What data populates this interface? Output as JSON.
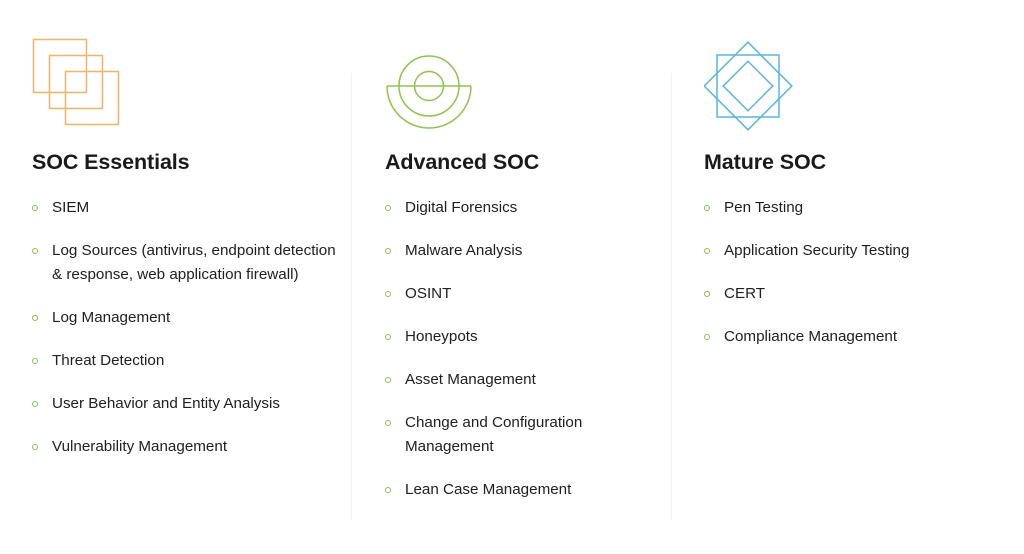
{
  "page": {
    "background_color": "#ffffff",
    "divider_color": "#f2f2f4",
    "bullet_color": "#8dbf4f",
    "title_color": "#1a1a1a",
    "text_color": "#20201f"
  },
  "columns": [
    {
      "id": "soc-essentials",
      "title": "SOC Essentials",
      "icon": "overlapping-squares-icon",
      "icon_color": "#e8b873",
      "items": [
        "SIEM",
        "Log Sources (antivirus, endpoint detection & response, web application firewall)",
        "Log Management",
        "Threat Detection",
        "User Behavior and Entity Analysis",
        "Vulnerability Management"
      ]
    },
    {
      "id": "advanced-soc",
      "title": "Advanced SOC",
      "icon": "concentric-circles-icon",
      "icon_color": "#8fc250",
      "items": [
        "Digital Forensics",
        "Malware Analysis",
        "OSINT",
        "Honeypots",
        "Asset Management",
        "Change and Configuration Management",
        "Lean Case Management"
      ]
    },
    {
      "id": "mature-soc",
      "title": "Mature SOC",
      "icon": "square-diamond-icon",
      "icon_color": "#5bb3dd",
      "items": [
        "Pen Testing",
        "Application Security Testing",
        "CERT",
        "Compliance Management"
      ]
    }
  ]
}
